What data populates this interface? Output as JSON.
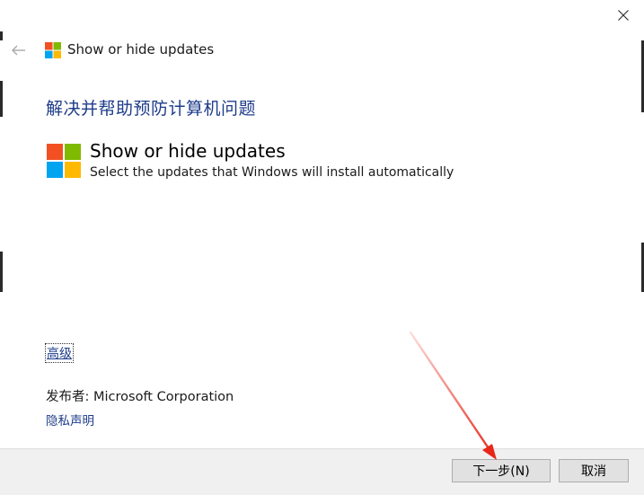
{
  "window": {
    "title": "Show or hide updates"
  },
  "wizard": {
    "heading": "解决并帮助预防计算机问题",
    "tool_title": "Show or hide updates",
    "tool_description": "Select the updates that Windows will install automatically",
    "advanced_label": "高级",
    "publisher_text": "发布者:  Microsoft Corporation",
    "privacy_label": "隐私声明"
  },
  "footer": {
    "next_label": "下一步(N)",
    "cancel_label": "取消"
  },
  "icons": {
    "close": "close-icon",
    "back": "back-arrow-icon",
    "logo": "windows-logo-icon"
  },
  "colors": {
    "heading_blue": "#1e3c8a",
    "logo_red": "#f25022",
    "logo_green": "#7fba00",
    "logo_blue": "#00a4ef",
    "logo_yellow": "#ffb900",
    "annotation_arrow": "#e8261a"
  }
}
